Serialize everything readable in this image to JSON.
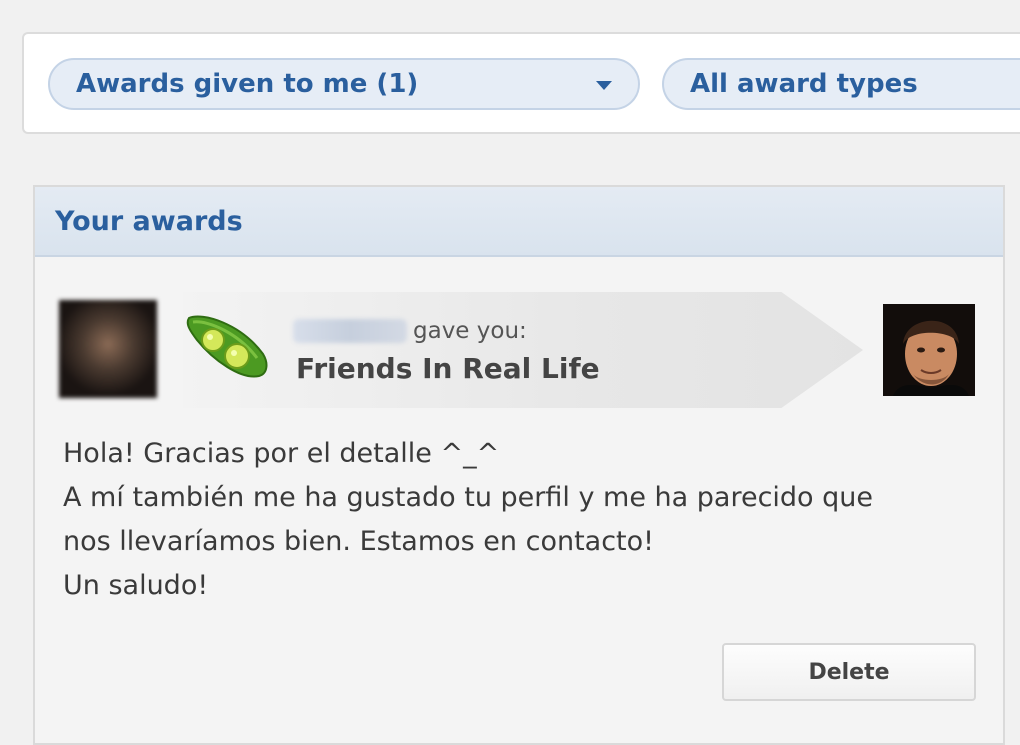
{
  "filters": {
    "given_label": "Awards given to me (1)",
    "types_label": "All award types"
  },
  "panel": {
    "title": "Your awards"
  },
  "award": {
    "gave_text": "gave you:",
    "award_name": "Friends In Real Life",
    "icon": "green-pea-pod-icon"
  },
  "message": {
    "lines": [
      "Hola! Gracias por el detalle ^_^",
      "A mí también me ha gustado tu perfil y me ha parecido que",
      "nos llevaríamos bien. Estamos en contacto!",
      "Un saludo!"
    ]
  },
  "actions": {
    "delete_label": "Delete"
  },
  "colors": {
    "accent": "#2a5f9e",
    "pill_bg": "#e6edf6",
    "pea_green": "#5aa82a"
  }
}
